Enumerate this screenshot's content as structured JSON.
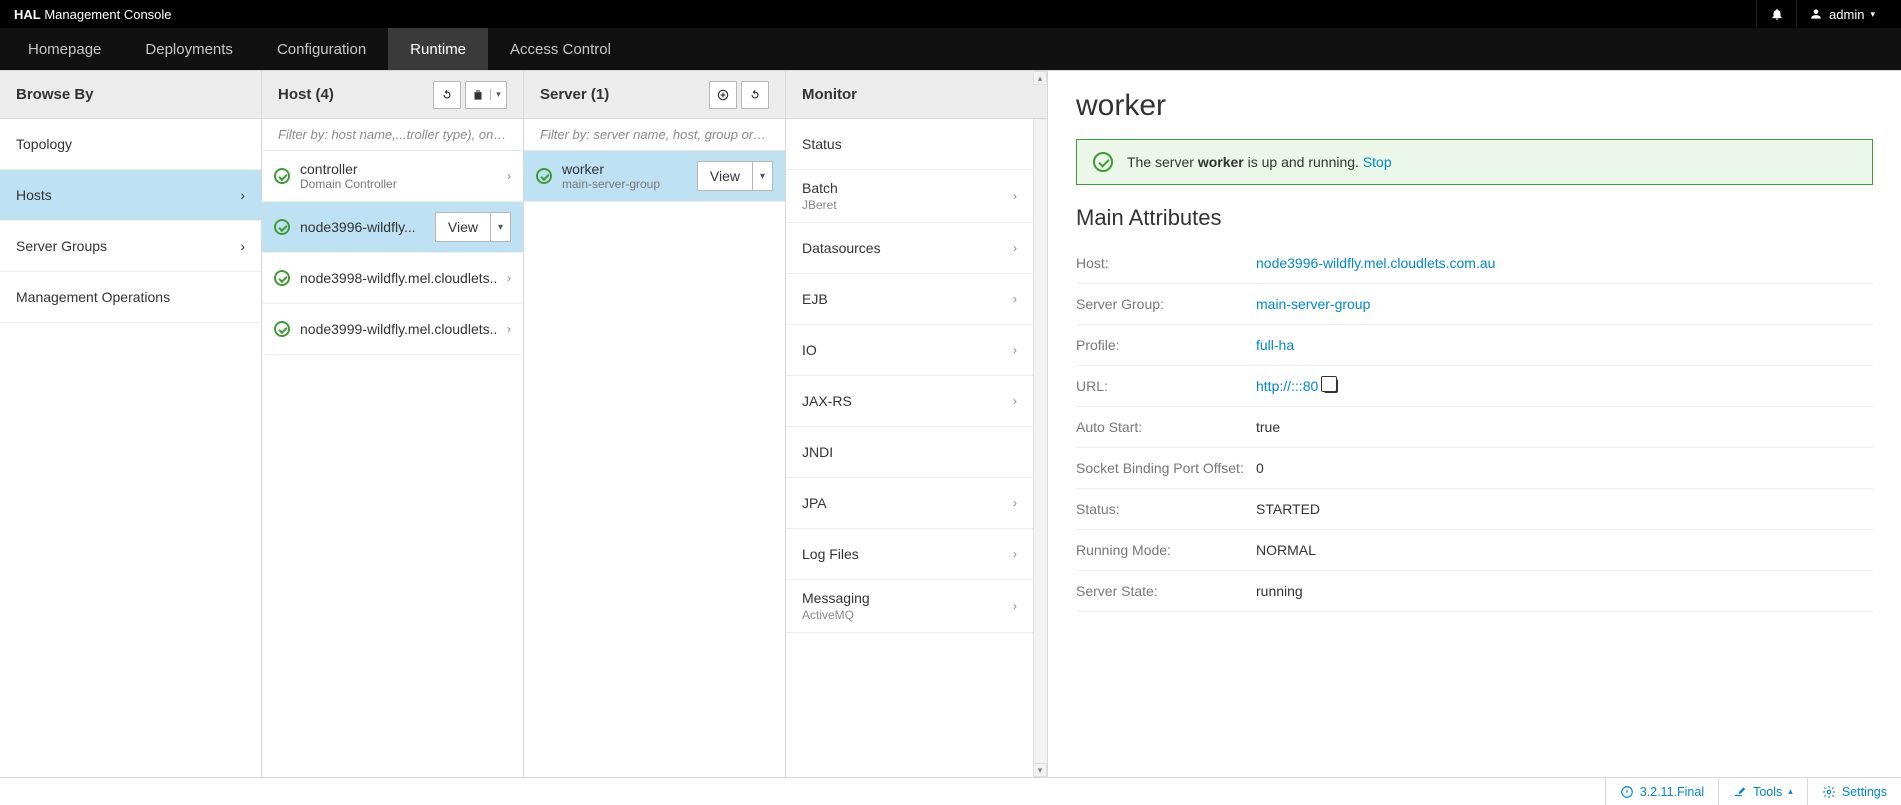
{
  "header": {
    "brand_strong": "HAL",
    "brand_rest": " Management Console",
    "user": "admin"
  },
  "nav": {
    "items": [
      "Homepage",
      "Deployments",
      "Configuration",
      "Runtime",
      "Access Control"
    ],
    "active_index": 3
  },
  "browse": {
    "title": "Browse By",
    "items": [
      {
        "label": "Topology",
        "chevron": false
      },
      {
        "label": "Hosts",
        "chevron": true,
        "selected": true
      },
      {
        "label": "Server Groups",
        "chevron": true
      },
      {
        "label": "Management Operations",
        "chevron": false
      }
    ]
  },
  "hosts": {
    "title": "Host (4)",
    "filter_placeholder": "Filter by: host name,...troller type), on/off",
    "items": [
      {
        "name": "controller",
        "sub": "Domain Controller",
        "chevron": true
      },
      {
        "name": "node3996-wildfly...",
        "selected": true,
        "view_button": true
      },
      {
        "name": "node3998-wildfly.mel.cloudlets...",
        "chevron": true
      },
      {
        "name": "node3999-wildfly.mel.cloudlets...",
        "chevron": true
      }
    ],
    "view_label": "View"
  },
  "servers": {
    "title": "Server (1)",
    "filter_placeholder": "Filter by: server name, host, group or status",
    "items": [
      {
        "name": "worker",
        "sub": "main-server-group",
        "selected": true,
        "view_button": true
      }
    ],
    "view_label": "View"
  },
  "monitor": {
    "title": "Monitor",
    "items": [
      {
        "label": "Status"
      },
      {
        "label": "Batch",
        "sub": "JBeret",
        "chevron": true
      },
      {
        "label": "Datasources",
        "chevron": true
      },
      {
        "label": "EJB",
        "chevron": true
      },
      {
        "label": "IO",
        "chevron": true
      },
      {
        "label": "JAX-RS",
        "chevron": true
      },
      {
        "label": "JNDI"
      },
      {
        "label": "JPA",
        "chevron": true
      },
      {
        "label": "Log Files",
        "chevron": true
      },
      {
        "label": "Messaging",
        "sub": "ActiveMQ",
        "chevron": true
      }
    ]
  },
  "detail": {
    "title": "worker",
    "alert_prefix": "The server ",
    "alert_bold": "worker",
    "alert_suffix": " is up and running. ",
    "alert_link": "Stop",
    "section_title": "Main Attributes",
    "attrs": [
      {
        "label": "Host:",
        "value": "node3996-wildfly.mel.cloudlets.com.au",
        "link": true
      },
      {
        "label": "Server Group:",
        "value": "main-server-group",
        "link": true
      },
      {
        "label": "Profile:",
        "value": "full-ha",
        "link": true
      },
      {
        "label": "URL:",
        "value": "http://:::80",
        "link": true,
        "copy": true
      },
      {
        "label": "Auto Start:",
        "value": "true"
      },
      {
        "label": "Socket Binding Port Offset:",
        "value": "0"
      },
      {
        "label": "Status:",
        "value": "STARTED"
      },
      {
        "label": "Running Mode:",
        "value": "NORMAL"
      },
      {
        "label": "Server State:",
        "value": "running"
      }
    ]
  },
  "footer": {
    "version": "3.2.11.Final",
    "tools": "Tools",
    "settings": "Settings"
  }
}
